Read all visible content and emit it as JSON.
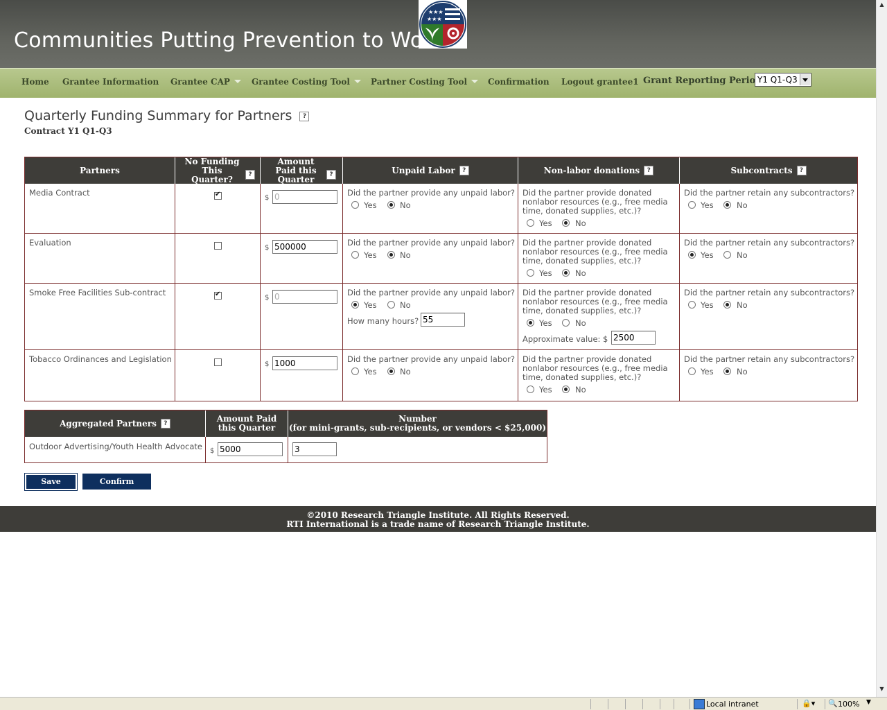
{
  "header": {
    "site_title": "Communities Putting Prevention to Work"
  },
  "nav": {
    "items": [
      {
        "label": "Home",
        "dropdown": false
      },
      {
        "label": "Grantee Information",
        "dropdown": false
      },
      {
        "label": "Grantee CAP",
        "dropdown": true
      },
      {
        "label": "Grantee Costing Tool",
        "dropdown": true
      },
      {
        "label": "Partner Costing Tool",
        "dropdown": true
      },
      {
        "label": "Confirmation",
        "dropdown": false
      },
      {
        "label": "Logout grantee1",
        "dropdown": false
      }
    ],
    "period_label": "Grant Reporting Period:",
    "period_value": "Y1 Q1-Q3"
  },
  "page": {
    "title": "Quarterly Funding Summary for Partners",
    "subtitle": "Contract Y1 Q1-Q3",
    "help": "?"
  },
  "partners_table": {
    "headers": {
      "partners": "Partners",
      "no_funding": "No Funding This Quarter?",
      "amount_paid": "Amount Paid this Quarter",
      "unpaid_labor": "Unpaid Labor",
      "nonlabor": "Non-labor donations",
      "subcontracts": "Subcontracts"
    },
    "q_unpaid": "Did the partner provide any unpaid labor?",
    "q_nonlabor": "Did the partner provide donated nonlabor resources (e.g., free media time, donated supplies, etc.)?",
    "q_subcontract": "Did the partner retain any subcontractors?",
    "yes": "Yes",
    "no": "No",
    "dollar": "$",
    "hours_label": "How many hours?",
    "approx_label": "Approximate value: $",
    "rows": [
      {
        "name": "Media Contract",
        "no_funding": true,
        "amount": "0",
        "unpaid": "No",
        "nonlabor": "No",
        "subcontract": "No"
      },
      {
        "name": "Evaluation",
        "no_funding": false,
        "amount": "500000",
        "unpaid": "No",
        "nonlabor": "No",
        "subcontract": "Yes"
      },
      {
        "name": "Smoke Free Facilities Sub-contract",
        "no_funding": true,
        "amount": "0",
        "unpaid": "Yes",
        "hours": "55",
        "nonlabor": "Yes",
        "approx_value": "2500",
        "subcontract": "No"
      },
      {
        "name": "Tobacco Ordinances and Legislation",
        "no_funding": false,
        "amount": "1000",
        "unpaid": "No",
        "nonlabor": "No",
        "subcontract": "No"
      }
    ]
  },
  "aggregated_table": {
    "headers": {
      "partners": "Aggregated Partners",
      "amount": "Amount Paid this Quarter",
      "number_line1": "Number",
      "number_line2": "(for mini-grants, sub-recipients, or vendors < $25,000)"
    },
    "row": {
      "name": "Outdoor Advertising/Youth Health Advocate",
      "amount": "5000",
      "number": "3"
    }
  },
  "buttons": {
    "save": "Save",
    "confirm": "Confirm"
  },
  "footer": {
    "line1": "©2010 Research Triangle Institute. All Rights Reserved.",
    "line2": "RTI International is a trade name of Research Triangle Institute."
  },
  "statusbar": {
    "zone": "Local intranet",
    "zoom": "100%"
  },
  "colors": {
    "header_bg": "#5f615b",
    "nav_bg": "#a9bb7a",
    "table_header": "#3e3d39",
    "button": "#0e2f5e",
    "border": "#7a2b2b"
  }
}
